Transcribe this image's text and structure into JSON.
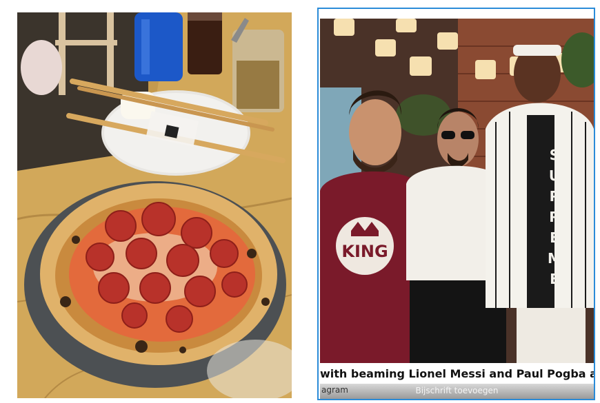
{
  "left_image": {
    "alt": "pizza-photo"
  },
  "right_image": {
    "caption": "with beaming Lionel Messi and Paul Pogba at his Du",
    "source": "agram",
    "add_caption_label": "Bijschrift toevoegen",
    "shirt_text": "KING",
    "jacket_letters": [
      "S",
      "U",
      "P",
      "R",
      "E",
      "M",
      "E"
    ]
  },
  "colors": {
    "frame_border": "#2a8bd8"
  }
}
